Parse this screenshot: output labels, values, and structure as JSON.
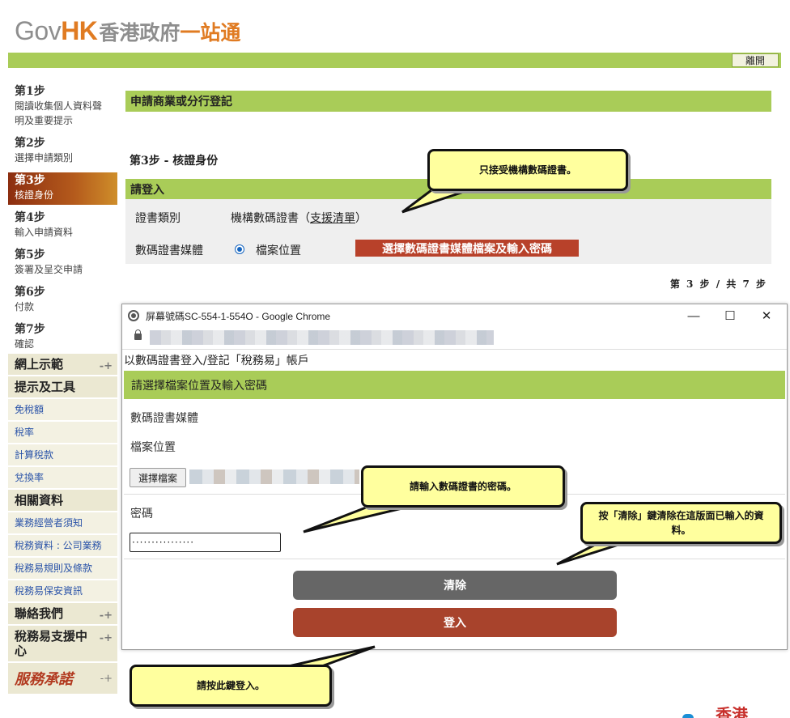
{
  "header": {
    "logo_gov": "Gov",
    "logo_hk": "HK",
    "logo_zh": "香港政府",
    "logo_zh2": "一站通",
    "logout_label": "離開"
  },
  "steps": [
    {
      "title": "第1步",
      "desc": "閱讀收集個人資料聲明及重要提示"
    },
    {
      "title": "第2步",
      "desc": "選擇申請類別"
    },
    {
      "title": "第3步",
      "desc": "核證身份"
    },
    {
      "title": "第4步",
      "desc": "輸入申請資料"
    },
    {
      "title": "第5步",
      "desc": "簽署及呈交申請"
    },
    {
      "title": "第6步",
      "desc": "付款"
    },
    {
      "title": "第7步",
      "desc": "確認"
    }
  ],
  "menu": {
    "demo": "網上示範",
    "tips": "提示及工具",
    "tips_items": [
      "免稅額",
      "稅率",
      "計算稅款",
      "兌換率"
    ],
    "related": "相關資料",
    "related_items": [
      "業務經營者須知",
      "稅務資料 : 公司業務",
      "稅務易規則及條款",
      "稅務易保安資訊"
    ],
    "contact": "聯絡我們",
    "support": "稅務易支援中心",
    "brand": "服務承諾",
    "expand_icon": "plus-arrow-icon"
  },
  "main": {
    "section_title": "申請商業或分行登記",
    "step_heading": "第3步 - 核證身份",
    "login_bar": "請登入",
    "cert_type_label": "證書類別",
    "cert_type_value": "機構數碼證書（",
    "cert_type_link": "支援清單",
    "cert_type_close": "）",
    "medium_label": "數碼證書媒體",
    "medium_option": "檔案位置",
    "select_button": "選擇數碼證書媒體檔案及輸入密碼",
    "page_info": "第 3 步 / 共 7 步"
  },
  "popup": {
    "window_title": "屏幕號碼SC-554-1-554O - Google Chrome",
    "minimize": "—",
    "maximize": "☐",
    "close": "✕",
    "page_title": "以數碼證書登入/登記「稅務易」帳戶",
    "bar": "請選擇檔案位置及輸入密碼",
    "medium_label": "數碼證書媒體",
    "file_label": "檔案位置",
    "choose_button": "選擇檔案",
    "password_label": "密碼",
    "password_value": "················",
    "clear_button": "清除",
    "login_button": "登入"
  },
  "callouts": {
    "org_cert_only": "只接受機構數碼證書。",
    "enter_password": "請輸入數碼證書的密碼。",
    "clear_info": "按「清除」鍵清除在這版面已輸入的資料。",
    "press_login": "請按此鍵登入。"
  },
  "footer": {
    "logo_partial": "香港"
  },
  "colors": {
    "green_bar": "#a9cc58",
    "active_step": "#a8432c",
    "accent_orange": "#e07b22",
    "callout_bg": "#ffff9e",
    "link_blue": "#2a53a8"
  }
}
